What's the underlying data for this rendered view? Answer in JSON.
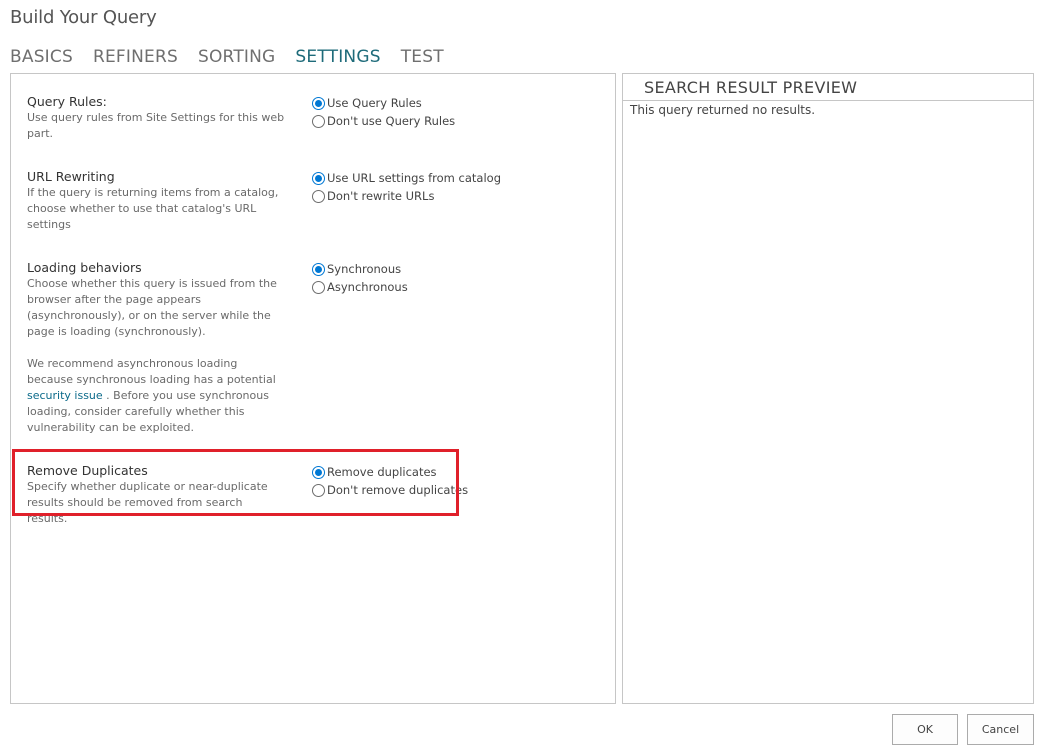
{
  "dialog": {
    "title": "Build Your Query"
  },
  "tabs": [
    {
      "label": "BASICS",
      "active": false
    },
    {
      "label": "REFINERS",
      "active": false
    },
    {
      "label": "SORTING",
      "active": false
    },
    {
      "label": "SETTINGS",
      "active": true
    },
    {
      "label": "TEST",
      "active": false
    }
  ],
  "settings": {
    "query_rules": {
      "title": "Query Rules:",
      "description": "Use query rules from Site Settings for this web part.",
      "options": [
        {
          "label": "Use Query Rules",
          "checked": true
        },
        {
          "label": "Don't use Query Rules",
          "checked": false
        }
      ]
    },
    "url_rewriting": {
      "title": "URL Rewriting",
      "description": "If the query is returning items from a catalog, choose whether to use that catalog's URL settings",
      "options": [
        {
          "label": "Use URL settings from catalog",
          "checked": true
        },
        {
          "label": "Don't rewrite URLs",
          "checked": false
        }
      ]
    },
    "loading_behaviors": {
      "title": "Loading behaviors",
      "description": "Choose whether this query is issued from the browser after the page appears (asynchronously), or on the server while the page is loading (synchronously).",
      "recommendation_before": "We recommend asynchronous loading because synchronous loading has a potential ",
      "link_text": "security issue",
      "recommendation_after": " . Before you use synchronous loading, consider carefully whether this vulnerability can be exploited.",
      "options": [
        {
          "label": "Synchronous",
          "checked": true
        },
        {
          "label": "Asynchronous",
          "checked": false
        }
      ]
    },
    "remove_duplicates": {
      "title": "Remove Duplicates",
      "description": "Specify whether duplicate or near-duplicate results should be removed from search results.",
      "options": [
        {
          "label": "Remove duplicates",
          "checked": true
        },
        {
          "label": "Don't remove duplicates",
          "checked": false
        }
      ]
    }
  },
  "preview": {
    "header": "SEARCH RESULT PREVIEW",
    "message": "This query returned no results."
  },
  "buttons": {
    "ok": "OK",
    "cancel": "Cancel"
  },
  "colors": {
    "accent": "#0078d4",
    "active_tab": "#1e6b7a",
    "highlight": "#e0202a",
    "link": "#0b6a8a"
  }
}
